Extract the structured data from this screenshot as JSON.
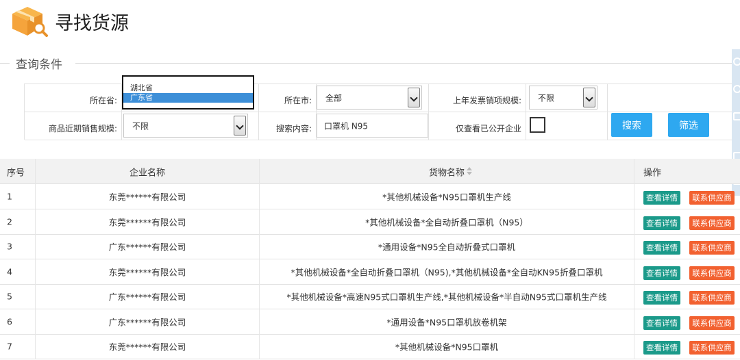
{
  "header": {
    "title": "寻找货源",
    "logo_icon": "box-search-icon"
  },
  "query_section": {
    "title": "查询条件"
  },
  "filters": {
    "province": {
      "label": "所在省:",
      "options": [
        "湖北省",
        "广东省"
      ],
      "selected": "广东省"
    },
    "city": {
      "label": "所在市:",
      "value": "全部"
    },
    "invoice_scale": {
      "label": "上年发票销项规模:",
      "value": "不限"
    },
    "sales_scale": {
      "label": "商品近期销售规模:",
      "value": "不限"
    },
    "search_content": {
      "label": "搜索内容:",
      "value": "口罩机 N95"
    },
    "public_only": {
      "label": "仅查看已公开企业",
      "checked": false
    },
    "search_button": "搜索",
    "filter_button": "筛选"
  },
  "table": {
    "headers": {
      "index": "序号",
      "company": "企业名称",
      "goods": "货物名称",
      "actions": "操作"
    },
    "action_labels": {
      "detail": "查看详情",
      "contact": "联系供应商"
    },
    "rows": [
      {
        "index": "1",
        "company": "东莞******有限公司",
        "goods": "*其他机械设备*N95口罩机生产线"
      },
      {
        "index": "2",
        "company": "东莞******有限公司",
        "goods": "*其他机械设备*全自动折叠口罩机（N95）"
      },
      {
        "index": "3",
        "company": "广东******有限公司",
        "goods": "*通用设备*N95全自动折叠式口罩机"
      },
      {
        "index": "4",
        "company": "东莞******有限公司",
        "goods": "*其他机械设备*全自动折叠口罩机（N95),*其他机械设备*全自动KN95折叠口罩机"
      },
      {
        "index": "5",
        "company": "广东******有限公司",
        "goods": "*其他机械设备*高速N95式口罩机生产线,*其他机械设备*半自动N95式口罩机生产线"
      },
      {
        "index": "6",
        "company": "广东******有限公司",
        "goods": "*通用设备*N95口罩机放卷机架"
      },
      {
        "index": "7",
        "company": "东莞******有限公司",
        "goods": "*其他机械设备*N95口罩机"
      }
    ]
  },
  "colors": {
    "accent_blue": "#2ea8f0",
    "detail_green": "#1b9a8a",
    "contact_orange": "#f26130",
    "logo_orange": "#f5a43c"
  }
}
